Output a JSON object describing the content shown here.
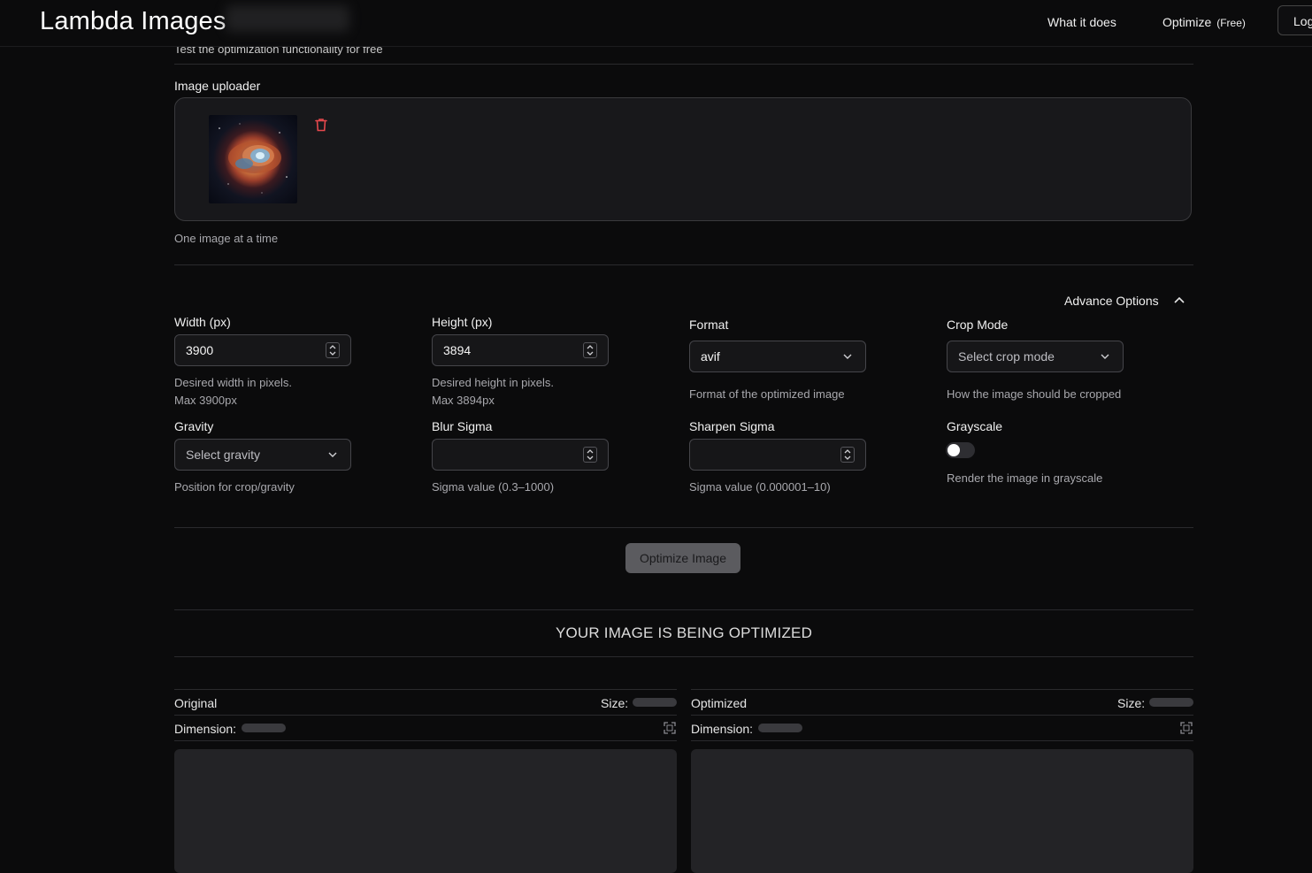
{
  "header": {
    "brand": "Lambda Images",
    "nav": {
      "what_it_does": "What it does",
      "optimize": "Optimize",
      "optimize_badge": "(Free)",
      "login": "Log"
    }
  },
  "intro": {
    "subtitle": "Test the optimization functionality for free"
  },
  "uploader": {
    "label": "Image uploader",
    "help": "One image at a time"
  },
  "advanced": {
    "toggle_label": "Advance Options"
  },
  "fields": {
    "width": {
      "label": "Width (px)",
      "value": "3900",
      "help1": "Desired width in pixels.",
      "help2": "Max 3900px"
    },
    "height": {
      "label": "Height (px)",
      "value": "3894",
      "help1": "Desired height in pixels.",
      "help2": "Max 3894px"
    },
    "format": {
      "label": "Format",
      "value": "avif",
      "help": "Format of the optimized image"
    },
    "crop": {
      "label": "Crop Mode",
      "placeholder": "Select crop mode",
      "help": "How the image should be cropped"
    },
    "gravity": {
      "label": "Gravity",
      "placeholder": "Select gravity",
      "help": "Position for crop/gravity"
    },
    "blur": {
      "label": "Blur Sigma",
      "value": "",
      "help": "Sigma value (0.3–1000)"
    },
    "sharpen": {
      "label": "Sharpen Sigma",
      "value": "",
      "help": "Sigma value (0.000001–10)"
    },
    "grayscale": {
      "label": "Grayscale",
      "checked": false,
      "help": "Render the image in grayscale"
    }
  },
  "actions": {
    "optimize_button": "Optimize Image"
  },
  "status": {
    "message": "YOUR IMAGE IS BEING OPTIMIZED"
  },
  "comparison": {
    "original": {
      "title": "Original",
      "size_label": "Size:",
      "dimension_label": "Dimension:"
    },
    "optimized": {
      "title": "Optimized",
      "size_label": "Size:",
      "dimension_label": "Dimension:"
    }
  },
  "icons": {
    "trash": "trash-icon",
    "chevron": "chevron-down-icon",
    "chevron_up": "chevron-up-icon",
    "spinner": "number-stepper-icon",
    "expand": "expand-icon"
  },
  "colors": {
    "background": "#0b0b0c",
    "danger": "#e5484d",
    "button_disabled": "#5b5b5f"
  }
}
